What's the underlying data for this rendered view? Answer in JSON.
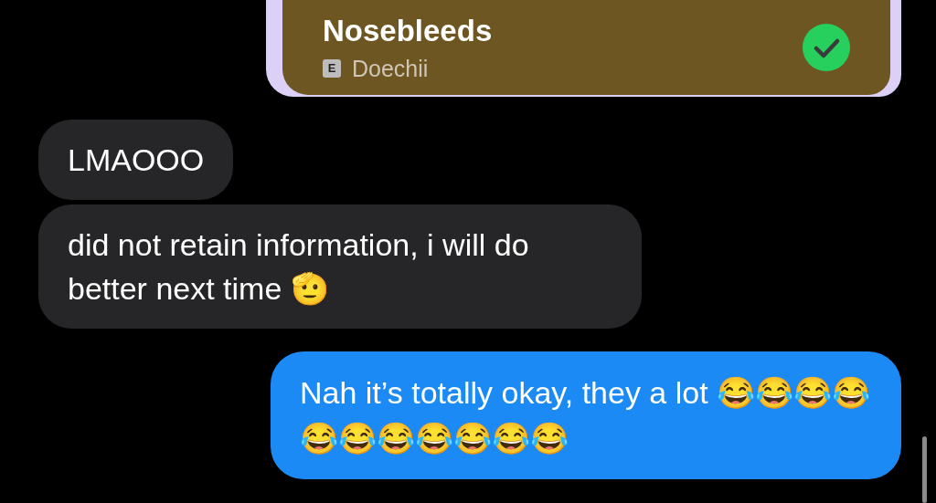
{
  "messages": [
    {
      "kind": "song",
      "sent": true,
      "title": "Nosebleeds",
      "explicit_badge": "E",
      "artist": "Doechii",
      "saved": true
    },
    {
      "kind": "text",
      "sent": false,
      "text": "LMAOOO"
    },
    {
      "kind": "text",
      "sent": false,
      "text": "did not retain information, i will do better next time 🫡"
    },
    {
      "kind": "text",
      "sent": true,
      "text": "Nah it’s totally okay, they a lot 😂😂😂😂😂😂😂😂😂😂😂"
    }
  ]
}
